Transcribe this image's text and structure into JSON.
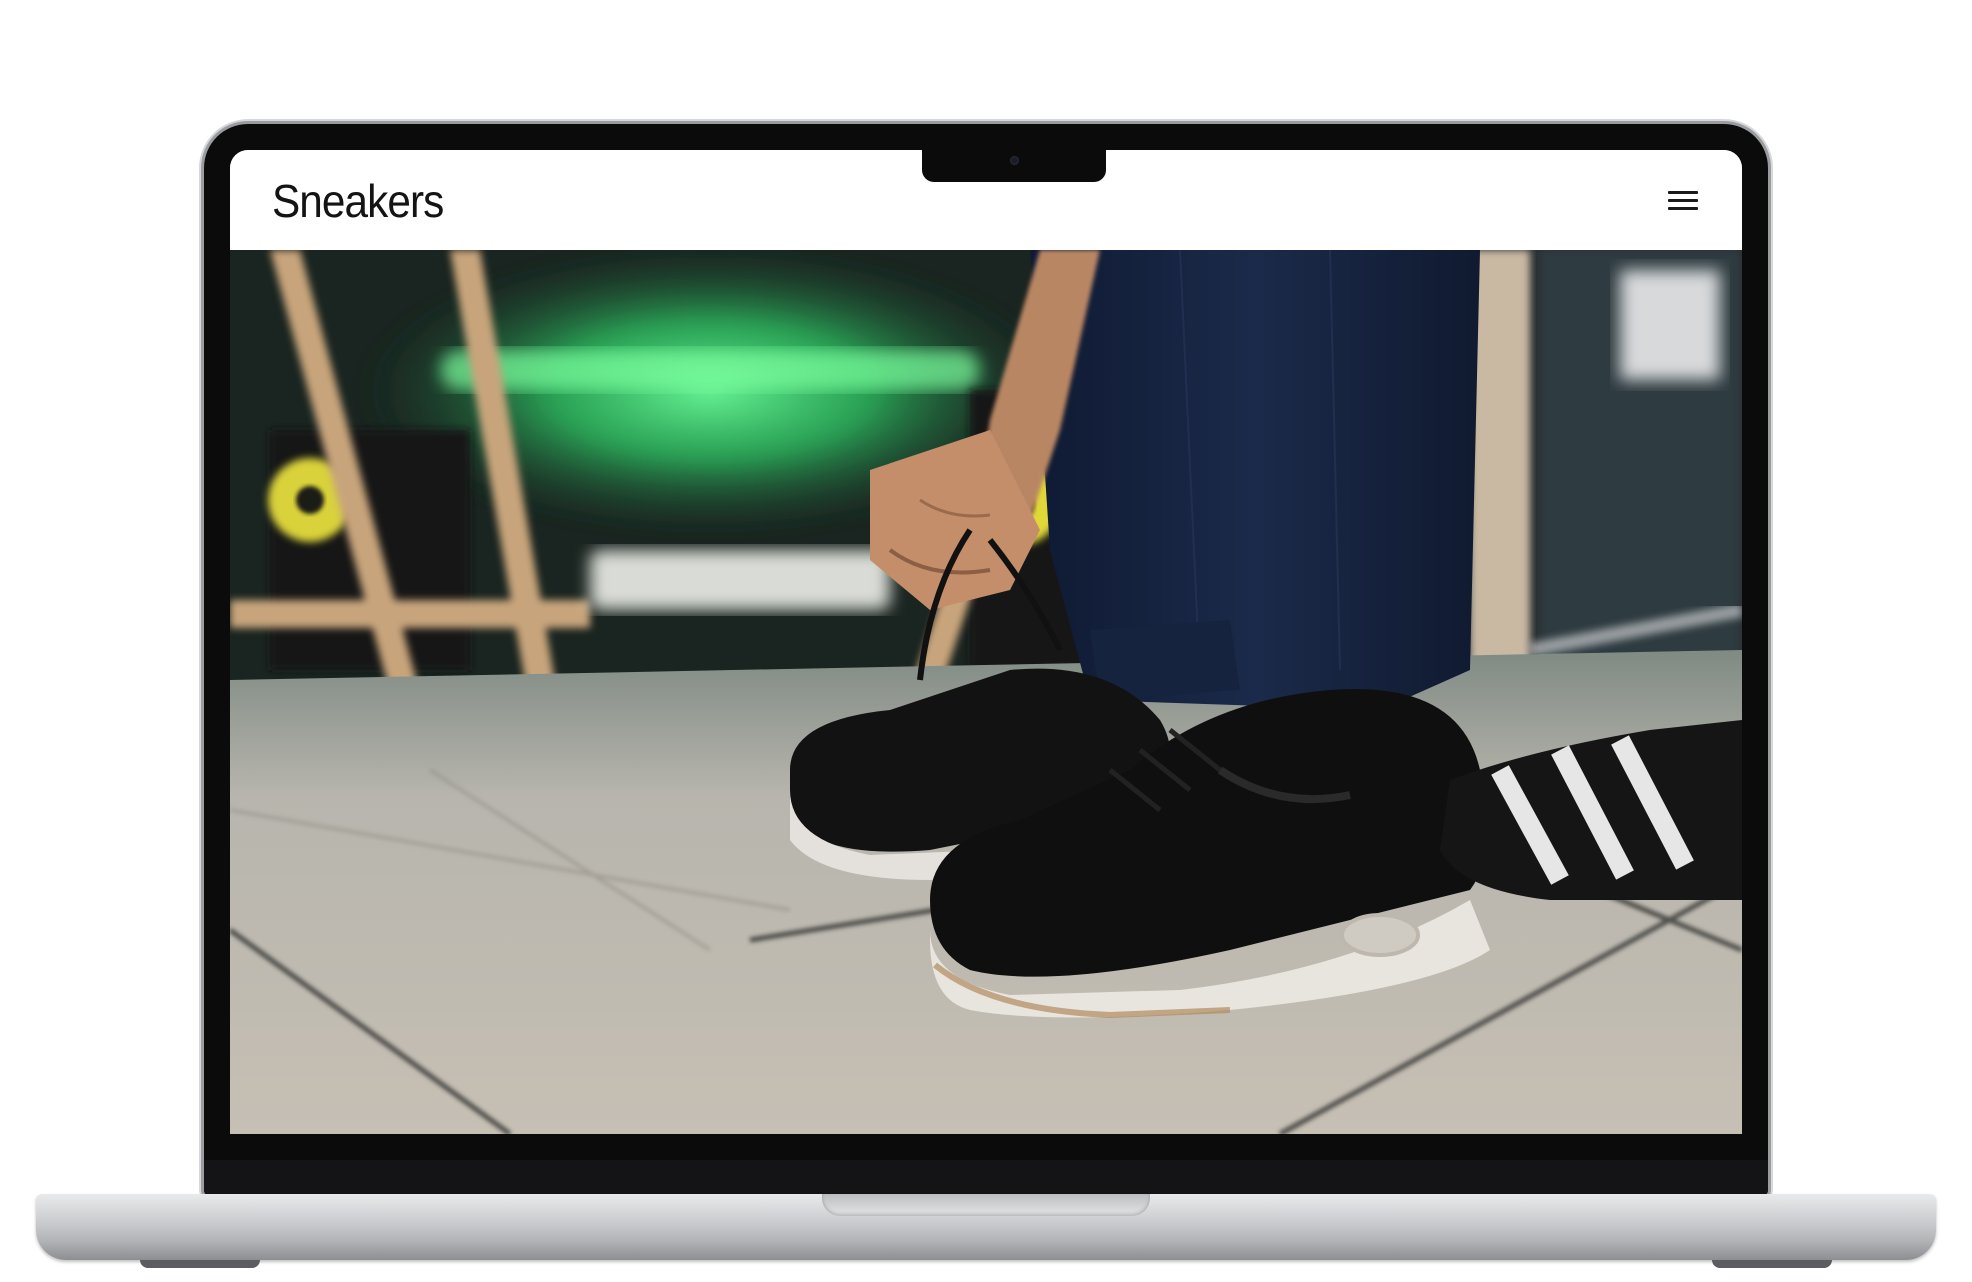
{
  "site": {
    "brand": "Sneakers",
    "menu_icon": "hamburger-menu-icon"
  },
  "hero": {
    "image_subject": "sneakers-photo"
  },
  "colors": {
    "header_bg": "#ffffff",
    "brand_text": "#141414",
    "bezel": "#0b0b0c",
    "chassis": "#c9cacd"
  }
}
